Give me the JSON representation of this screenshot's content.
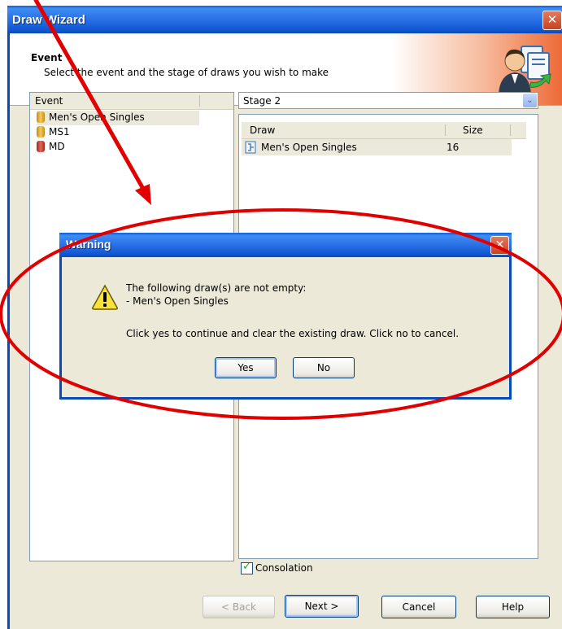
{
  "window": {
    "title": "Draw Wizard",
    "close_glyph": "✕"
  },
  "header": {
    "title": "Event",
    "subtitle": "Select the event and the stage of draws you wish to make",
    "icon": "user-documents-icon"
  },
  "event_list": {
    "column_header": "Event",
    "items": [
      {
        "label": "Men's Open Singles",
        "color": "#e8b53c",
        "selected": true
      },
      {
        "label": "MS1",
        "color": "#e8b53c",
        "selected": false
      },
      {
        "label": "MD",
        "color": "#cc4a3b",
        "selected": false
      }
    ]
  },
  "stage": {
    "value": "Stage 2",
    "arrow_glyph": "⌄"
  },
  "draw_list": {
    "columns": [
      "Draw",
      "Size"
    ],
    "rows": [
      {
        "draw": "Men's Open Singles",
        "size": "16"
      }
    ]
  },
  "consolation": {
    "label": "Consolation",
    "checked": true,
    "check_glyph": "✓"
  },
  "buttons": {
    "back": "< Back",
    "next": "Next >",
    "cancel": "Cancel",
    "help": "Help"
  },
  "warning": {
    "title": "Warning",
    "close_glyph": "✕",
    "line1": "The following draw(s) are not empty:",
    "line2": "- Men's Open Singles",
    "line3": "Click yes to continue and clear the existing draw. Click no to cancel.",
    "yes": "Yes",
    "no": "No"
  },
  "colors": {
    "annotation": "#e00000",
    "titlebar": "#0a5fd8",
    "header_accent": "#ee6a37"
  }
}
